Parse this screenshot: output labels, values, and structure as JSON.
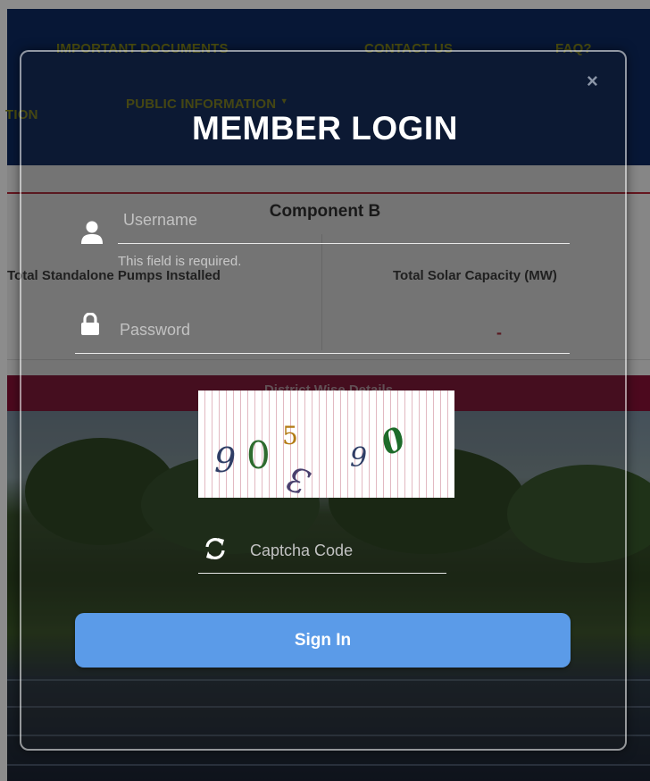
{
  "nav": {
    "links": [
      "IMPORTANT DOCUMENTS",
      "CONTACT US",
      "FAQ?"
    ],
    "partial_left": "TION",
    "public_info": "PUBLIC INFORMATION"
  },
  "stats": {
    "component_title": "Component B",
    "standalone_label": "Total Standalone Pumps Installed",
    "solar_label": "Total Solar Capacity (MW)",
    "solar_value": "-",
    "district_bar": "District Wise Details"
  },
  "modal": {
    "close": "×",
    "title": "MEMBER LOGIN",
    "username_placeholder": "Username",
    "username_error": "This field is required.",
    "password_placeholder": "Password",
    "captcha_text": [
      "9",
      "0",
      "5",
      "3",
      "9",
      "0"
    ],
    "captcha_placeholder": "Captcha Code",
    "signin_label": "Sign In"
  },
  "icons": {
    "username": "user-icon",
    "password": "lock-icon",
    "captcha_refresh": "refresh-icon",
    "close": "close-icon"
  },
  "colors": {
    "nav_bg": "#0d2a63",
    "accent_red": "#b8283a",
    "maroon": "#8a1237",
    "button": "#5b9be8"
  }
}
